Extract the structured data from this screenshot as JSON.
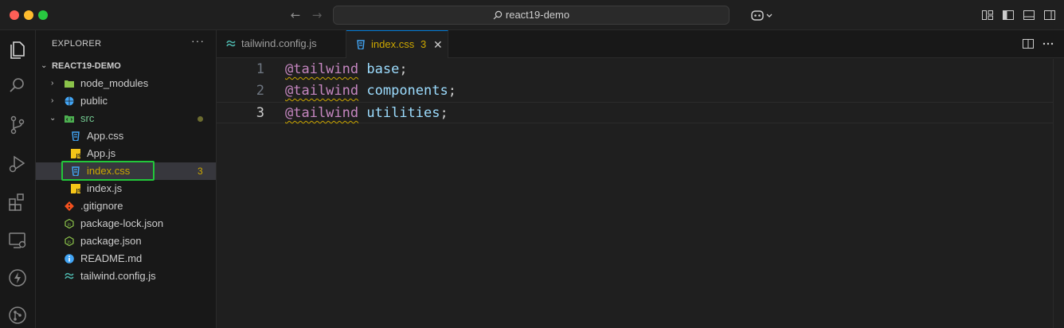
{
  "window": {
    "search_text": "react19-demo",
    "nav_back": "←",
    "nav_forward": "→"
  },
  "explorer": {
    "header": "EXPLORER",
    "more": "···",
    "root": "REACT19-DEMO",
    "items": [
      {
        "label": "node_modules",
        "kind": "folder",
        "icon": "folder-icon"
      },
      {
        "label": "public",
        "kind": "folder",
        "icon": "globe-folder-icon"
      },
      {
        "label": "src",
        "kind": "folder-open",
        "icon": "src-folder-icon"
      },
      {
        "label": "App.css",
        "kind": "file",
        "icon": "css-file-icon"
      },
      {
        "label": "App.js",
        "kind": "file",
        "icon": "js-file-icon"
      },
      {
        "label": "index.css",
        "kind": "file",
        "icon": "css-file-icon",
        "badge": "3"
      },
      {
        "label": "index.js",
        "kind": "file",
        "icon": "js-file-icon"
      },
      {
        "label": ".gitignore",
        "kind": "file",
        "icon": "git-file-icon"
      },
      {
        "label": "package-lock.json",
        "kind": "file",
        "icon": "npm-file-icon"
      },
      {
        "label": "package.json",
        "kind": "file",
        "icon": "npm-file-icon"
      },
      {
        "label": "README.md",
        "kind": "file",
        "icon": "info-file-icon"
      },
      {
        "label": "tailwind.config.js",
        "kind": "file",
        "icon": "tailwind-file-icon"
      }
    ]
  },
  "tabs": [
    {
      "label": "tailwind.config.js",
      "active": false
    },
    {
      "label": "index.css",
      "badge": "3",
      "close": "✕",
      "active": true
    }
  ],
  "code": {
    "lines": [
      {
        "number": "1",
        "keyword": "@tailwind",
        "argument": "base",
        "punct": ";"
      },
      {
        "number": "2",
        "keyword": "@tailwind",
        "argument": "components",
        "punct": ";"
      },
      {
        "number": "3",
        "keyword": "@tailwind",
        "argument": "utilities",
        "punct": ";"
      }
    ]
  },
  "colors": {
    "accent": "#0078d4",
    "warning": "#cca700",
    "keyword": "#c586c0",
    "focus_outline": "#22c73a"
  }
}
